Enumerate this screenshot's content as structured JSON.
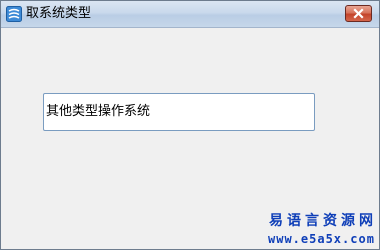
{
  "window": {
    "title": "取系统类型",
    "icon": "app-icon",
    "close_icon": "close-icon"
  },
  "main": {
    "text_field": {
      "value": "其他类型操作系统"
    }
  },
  "watermark": {
    "brand": "易语言资源网",
    "url": "www.e5a5x.com"
  },
  "colors": {
    "watermark": "#0f3fb8",
    "close_button": "#c4442b",
    "field_border": "#7a9cc0"
  }
}
